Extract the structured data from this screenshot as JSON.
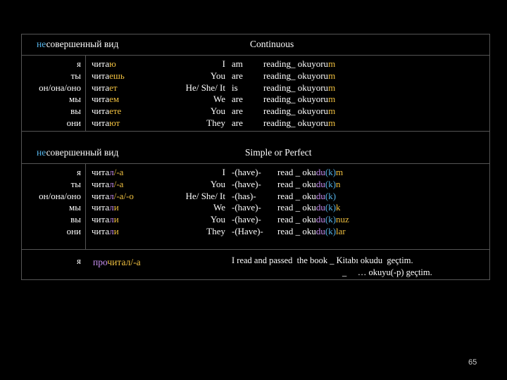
{
  "section1": {
    "left_header_prefix": "не",
    "left_header_rest": "совершенный вид",
    "right_header": "Continuous",
    "pronouns_ru": [
      "я",
      "ты",
      "он/она/оно",
      "мы",
      "вы",
      "они"
    ],
    "verbs_ru": [
      {
        "stem": "чита",
        "ending": "ю"
      },
      {
        "stem": "чита",
        "ending": "ешь"
      },
      {
        "stem": "чита",
        "ending": "ет"
      },
      {
        "stem": "чита",
        "ending": "ем"
      },
      {
        "stem": "чита",
        "ending": "ете"
      },
      {
        "stem": "чита",
        "ending": "ют"
      }
    ],
    "pronouns_en": [
      "I",
      "You",
      "He/ She/ It",
      "We",
      "You",
      "They"
    ],
    "aux_en": [
      "am",
      "are",
      "is",
      "are",
      "are",
      "are"
    ],
    "reading": [
      {
        "word": "reading_ okuyoru",
        "ending": "m"
      },
      {
        "word": "reading_ okuyoru",
        "ending": "m"
      },
      {
        "word": "reading_ okuyoru",
        "ending": "m"
      },
      {
        "word": "reading_ okuyoru",
        "ending": "m"
      },
      {
        "word": "reading_ okuyoru",
        "ending": "m"
      },
      {
        "word": "reading_ okuyoru",
        "ending": "m"
      }
    ]
  },
  "section2": {
    "left_header_prefix": "не",
    "left_header_rest": "совершенный вид",
    "right_header": "Simple or Perfect",
    "pronouns_ru": [
      "я",
      "ты",
      "он/она/оно",
      "мы",
      "вы",
      "они"
    ],
    "verbs_ru": [
      {
        "stem": "чита",
        "mid": "л",
        "ending": "/-а"
      },
      {
        "stem": "чита",
        "mid": "л",
        "ending": "/-а"
      },
      {
        "stem": "чита",
        "mid": "л",
        "ending": "/-а/-о"
      },
      {
        "stem": "чита",
        "mid": "л",
        "ending": "и"
      },
      {
        "stem": "чита",
        "mid": "л",
        "ending": "и"
      },
      {
        "stem": "чита",
        "mid": "л",
        "ending": "и"
      }
    ],
    "pronouns_en": [
      "I",
      "You",
      "He/ She/ It",
      "We",
      "You",
      "They"
    ],
    "aux_en": [
      "-(have)-",
      "-(have)-",
      "-(has)-",
      "-(have)-",
      "-(have)-",
      "-(Have)-"
    ],
    "read": [
      {
        "a": "read _ oku",
        "b": "du",
        "c": "(k)",
        "d": "m"
      },
      {
        "a": "read _ oku",
        "b": "du",
        "c": "(k)",
        "d": "n"
      },
      {
        "a": "read _ oku",
        "b": "du",
        "c": "(k)",
        "d": ""
      },
      {
        "a": "read _ oku",
        "b": "du",
        "c": "(k)",
        "d": "k"
      },
      {
        "a": "read _ oku",
        "b": "du",
        "c": "(k)",
        "d": "nuz"
      },
      {
        "a": "read _ oku",
        "b": "du",
        "c": "(k)",
        "d": "lar"
      }
    ]
  },
  "section3": {
    "pronoun": "я",
    "verb_prefix": "про",
    "verb_rest": "читал/-а",
    "sentence1": "I read and passed  the book _ Kitabı okudu  geçtim.",
    "sentence2": "_     … okuyu(-p) geçtim."
  },
  "page_number": "65"
}
